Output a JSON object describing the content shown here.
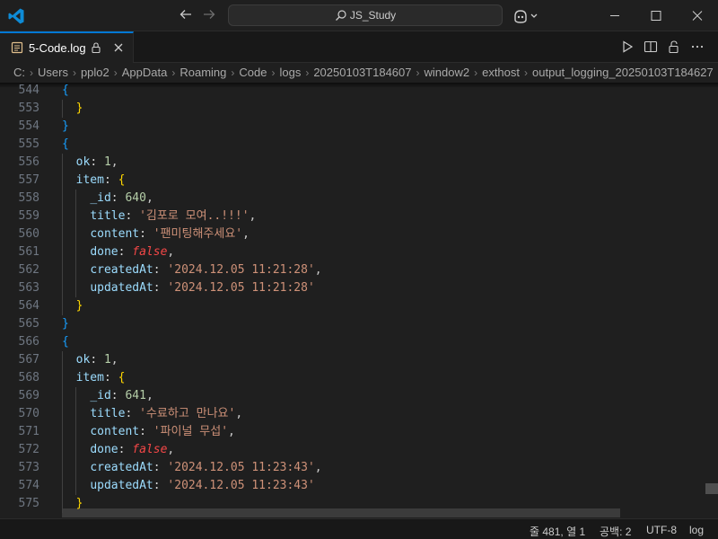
{
  "titlebar": {
    "search_text": "JS_Study"
  },
  "tab": {
    "label": "5-Code.log"
  },
  "breadcrumb": [
    "C:",
    "Users",
    "pplo2",
    "AppData",
    "Roaming",
    "Code",
    "logs",
    "20250103T184607",
    "window2",
    "exthost",
    "output_logging_20250103T184627"
  ],
  "editor": {
    "lines": [
      {
        "num": "544",
        "text": "{"
      },
      {
        "num": "553",
        "text": "  }"
      },
      {
        "num": "554",
        "text": "}"
      },
      {
        "num": "555",
        "text": "{"
      },
      {
        "num": "556",
        "text": "  ok: 1,"
      },
      {
        "num": "557",
        "text": "  item: {"
      },
      {
        "num": "558",
        "text": "    _id: 640,"
      },
      {
        "num": "559",
        "text": "    title: '김포로 모여..!!!',"
      },
      {
        "num": "560",
        "text": "    content: '팬미팅해주세요',"
      },
      {
        "num": "561",
        "text": "    done: false,"
      },
      {
        "num": "562",
        "text": "    createdAt: '2024.12.05 11:21:28',"
      },
      {
        "num": "563",
        "text": "    updatedAt: '2024.12.05 11:21:28'"
      },
      {
        "num": "564",
        "text": "  }"
      },
      {
        "num": "565",
        "text": "}"
      },
      {
        "num": "566",
        "text": "{"
      },
      {
        "num": "567",
        "text": "  ok: 1,"
      },
      {
        "num": "568",
        "text": "  item: {"
      },
      {
        "num": "569",
        "text": "    _id: 641,"
      },
      {
        "num": "570",
        "text": "    title: '수료하고 만나요',"
      },
      {
        "num": "571",
        "text": "    content: '파이널 무섭',"
      },
      {
        "num": "572",
        "text": "    done: false,"
      },
      {
        "num": "573",
        "text": "    createdAt: '2024.12.05 11:23:43',"
      },
      {
        "num": "574",
        "text": "    updatedAt: '2024.12.05 11:23:43'"
      },
      {
        "num": "575",
        "text": "  }"
      }
    ]
  },
  "statusbar": {
    "position": "줄 481, 열 1",
    "indent": "공백: 2",
    "encoding": "UTF-8",
    "language": "log"
  },
  "colors": {
    "accent": "#0078d4",
    "background": "#1f1f1f",
    "key": "#9cdcfe",
    "number": "#b5cea8",
    "string": "#ce9178",
    "keyword": "#f44747"
  }
}
